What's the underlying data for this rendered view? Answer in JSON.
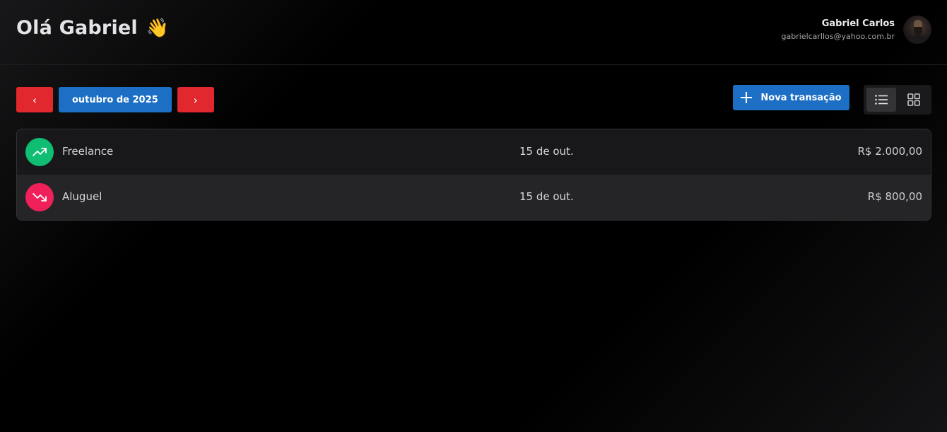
{
  "header": {
    "greeting": "Olá Gabriel",
    "wave_emoji": "👋",
    "user": {
      "name": "Gabriel Carlos",
      "email": "gabrielcarllos@yahoo.com.br"
    }
  },
  "month_nav": {
    "prev_label": "‹",
    "current_month": "outubro de 2025",
    "next_label": "›"
  },
  "actions": {
    "new_transaction_label": "Nova transação",
    "view_mode": "list"
  },
  "colors": {
    "accent_blue": "#1c6fc4",
    "nav_red": "#e0282e",
    "income_green": "#0fbd73",
    "expense_pink": "#f0215a"
  },
  "transactions": [
    {
      "name": "Freelance",
      "date": "15 de out.",
      "amount": "R$ 2.000,00",
      "type": "income",
      "icon": "trending-up-icon"
    },
    {
      "name": "Aluguel",
      "date": "15 de out.",
      "amount": "R$ 800,00",
      "type": "expense",
      "icon": "trending-down-icon"
    }
  ]
}
